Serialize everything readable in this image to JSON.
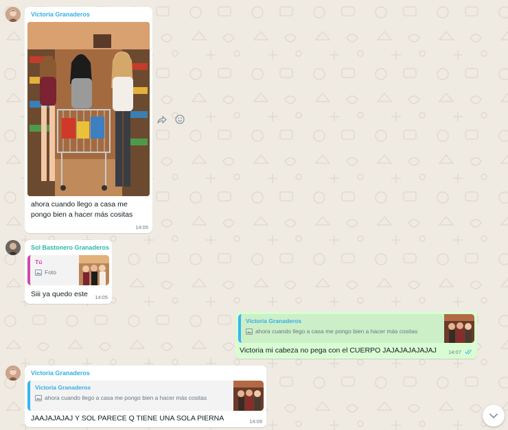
{
  "theme": {
    "wallpaper": "#efeae2",
    "incoming_bubble": "#ffffff",
    "outgoing_bubble": "#d9fdd3",
    "name_victoria": "#35aee4",
    "name_sol": "#2bb9a9",
    "name_you": "#d146a9",
    "tick_read": "#53bdeb"
  },
  "messages": [
    {
      "sender": "Victoria Granaderos",
      "avatar": "victoria-avatar",
      "type": "image",
      "caption_line1": "ahora cuando llego a casa me",
      "caption_line2": "pongo bien a hacer más cositas",
      "time": "14:05",
      "actions": [
        "forward-icon",
        "emoji-icon"
      ]
    },
    {
      "sender": "Sol Bastonero Granaderos",
      "avatar": "sol-avatar",
      "type": "reply",
      "quote_author": "Tú",
      "quote_text": "Foto",
      "text": "Siii ya quedo este",
      "time": "14:05"
    },
    {
      "direction": "out",
      "type": "reply",
      "quote_author": "Victoria Granaderos",
      "quote_text": "ahora cuando llego a casa me pongo bien a hacer más cositas",
      "text": "Victoria mi cabeza no pega con el CUERPO JAJAJAJAJAJAJ",
      "time": "14:07",
      "status": "read"
    },
    {
      "sender": "Victoria Granaderos",
      "avatar": "victoria-avatar",
      "type": "reply",
      "quote_author": "Victoria Granaderos",
      "quote_text": "ahora cuando llego a casa me pongo bien a hacer más cositas",
      "text": "JAAJAJAJAJ Y SOL PARECE Q TIENE UNA SOLA PIERNA",
      "time": "14:09"
    }
  ]
}
